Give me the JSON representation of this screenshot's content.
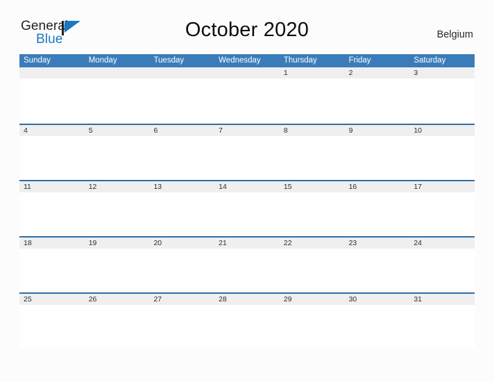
{
  "brand": {
    "word_one": "General",
    "word_two": "Blue",
    "flag_icon": "flag-triangle-icon",
    "colors": {
      "blue": "#1b77c4",
      "dark": "#231f20"
    }
  },
  "header": {
    "title": "October 2020",
    "country": "Belgium"
  },
  "calendar": {
    "month": "October",
    "year": "2020",
    "colors": {
      "header_blue": "#3a7cba",
      "row_rule": "#2e6da4",
      "day_strip": "#efefef",
      "page_background": "#fcfcfc"
    },
    "weekdays": [
      "Sunday",
      "Monday",
      "Tuesday",
      "Wednesday",
      "Thursday",
      "Friday",
      "Saturday"
    ],
    "weeks": [
      [
        "",
        "",
        "",
        "",
        "1",
        "2",
        "3"
      ],
      [
        "4",
        "5",
        "6",
        "7",
        "8",
        "9",
        "10"
      ],
      [
        "11",
        "12",
        "13",
        "14",
        "15",
        "16",
        "17"
      ],
      [
        "18",
        "19",
        "20",
        "21",
        "22",
        "23",
        "24"
      ],
      [
        "25",
        "26",
        "27",
        "28",
        "29",
        "30",
        "31"
      ]
    ]
  }
}
